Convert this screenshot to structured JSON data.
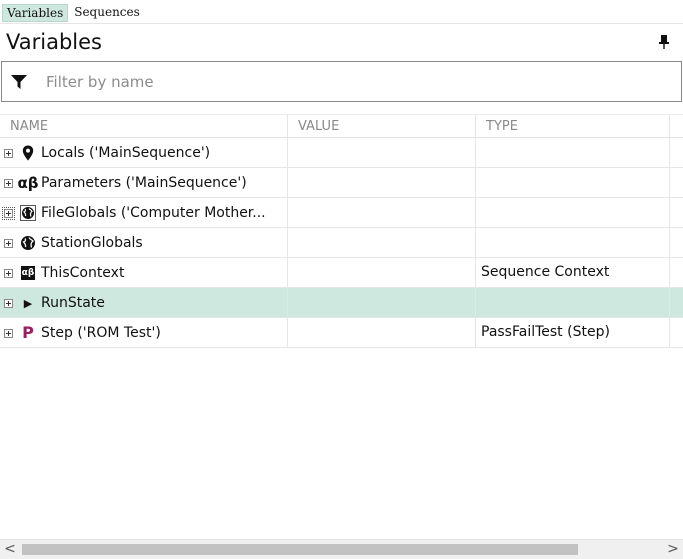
{
  "tabs": [
    {
      "label": "Variables",
      "active": true
    },
    {
      "label": "Sequences",
      "active": false
    }
  ],
  "panel": {
    "title": "Variables"
  },
  "filter": {
    "placeholder": "Filter by name",
    "value": ""
  },
  "columns": [
    "NAME",
    "VALUE",
    "TYPE",
    ""
  ],
  "rows": [
    {
      "icon": "location-pin-icon",
      "name": "Locals ('MainSequence')",
      "value": "",
      "type": ""
    },
    {
      "icon": "alpha-beta-icon",
      "name": "Parameters ('MainSequence')",
      "value": "",
      "type": ""
    },
    {
      "icon": "globe-icon",
      "name": "FileGlobals ('Computer Mother...",
      "value": "",
      "type": ""
    },
    {
      "icon": "globe-icon",
      "name": "StationGlobals",
      "value": "",
      "type": ""
    },
    {
      "icon": "context-icon",
      "name": "ThisContext",
      "value": "",
      "type": "Sequence Context"
    },
    {
      "icon": "play-icon",
      "name": "RunState",
      "value": "",
      "type": ""
    },
    {
      "icon": "step-p-icon",
      "name": "Step ('ROM Test')",
      "value": "",
      "type": "PassFailTest (Step)"
    }
  ],
  "selected_row_index": 5,
  "colors": {
    "selection": "#cfe8df",
    "step_icon": "#9a1f5e",
    "header_text": "#8a8a8a"
  },
  "scrollbar": {
    "left_arrow": "<",
    "right_arrow": ">"
  }
}
